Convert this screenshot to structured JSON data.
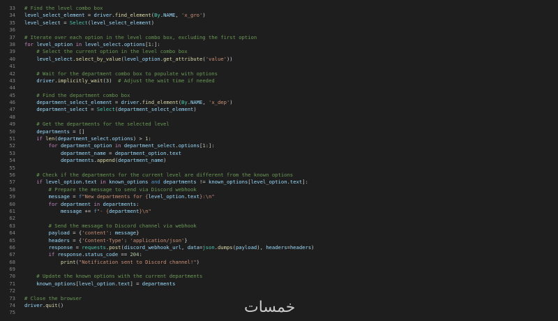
{
  "editor": {
    "language": "python",
    "watermark": "خمسات",
    "lines": [
      {
        "n": "33",
        "t": [
          [
            "c",
            "# Find the level combo box"
          ]
        ]
      },
      {
        "n": "34",
        "t": [
          [
            "v",
            "level_select_element"
          ],
          [
            "p",
            " = "
          ],
          [
            "v",
            "driver"
          ],
          [
            "p",
            "."
          ],
          [
            "f",
            "find_element"
          ],
          [
            "p",
            "("
          ],
          [
            "t",
            "By"
          ],
          [
            "p",
            "."
          ],
          [
            "v",
            "NAME"
          ],
          [
            "p",
            ", "
          ],
          [
            "s",
            "'x_gro'"
          ],
          [
            "p",
            ")"
          ]
        ]
      },
      {
        "n": "35",
        "t": [
          [
            "v",
            "level_select"
          ],
          [
            "p",
            " = "
          ],
          [
            "t",
            "Select"
          ],
          [
            "p",
            "("
          ],
          [
            "v",
            "level_select_element"
          ],
          [
            "p",
            ")"
          ]
        ]
      },
      {
        "n": "36",
        "t": []
      },
      {
        "n": "37",
        "t": [
          [
            "c",
            "# Iterate over each option in the level combo box, excluding the first option"
          ]
        ]
      },
      {
        "n": "38",
        "t": [
          [
            "k",
            "for"
          ],
          [
            "p",
            " "
          ],
          [
            "v",
            "level_option"
          ],
          [
            "p",
            " "
          ],
          [
            "k",
            "in"
          ],
          [
            "p",
            " "
          ],
          [
            "v",
            "level_select"
          ],
          [
            "p",
            "."
          ],
          [
            "v",
            "options"
          ],
          [
            "p",
            "["
          ],
          [
            "n",
            "1"
          ],
          [
            "p",
            ":]:"
          ]
        ]
      },
      {
        "n": "39",
        "t": [
          [
            "p",
            "    "
          ],
          [
            "c",
            "# Select the current option in the level combo box"
          ]
        ]
      },
      {
        "n": "40",
        "t": [
          [
            "p",
            "    "
          ],
          [
            "v",
            "level_select"
          ],
          [
            "p",
            "."
          ],
          [
            "f",
            "select_by_value"
          ],
          [
            "p",
            "("
          ],
          [
            "v",
            "level_option"
          ],
          [
            "p",
            "."
          ],
          [
            "f",
            "get_attribute"
          ],
          [
            "p",
            "("
          ],
          [
            "s",
            "'value'"
          ],
          [
            "p",
            "))"
          ]
        ]
      },
      {
        "n": "41",
        "t": []
      },
      {
        "n": "42",
        "t": [
          [
            "p",
            "    "
          ],
          [
            "c",
            "# Wait for the department combo box to populate with options"
          ]
        ]
      },
      {
        "n": "43",
        "t": [
          [
            "p",
            "    "
          ],
          [
            "v",
            "driver"
          ],
          [
            "p",
            "."
          ],
          [
            "f",
            "implicitly_wait"
          ],
          [
            "p",
            "("
          ],
          [
            "n",
            "3"
          ],
          [
            "p",
            ")  "
          ],
          [
            "c",
            "# Adjust the wait time if needed"
          ]
        ]
      },
      {
        "n": "44",
        "t": []
      },
      {
        "n": "45",
        "t": [
          [
            "p",
            "    "
          ],
          [
            "c",
            "# Find the department combo box"
          ]
        ]
      },
      {
        "n": "46",
        "t": [
          [
            "p",
            "    "
          ],
          [
            "v",
            "department_select_element"
          ],
          [
            "p",
            " = "
          ],
          [
            "v",
            "driver"
          ],
          [
            "p",
            "."
          ],
          [
            "f",
            "find_element"
          ],
          [
            "p",
            "("
          ],
          [
            "t",
            "By"
          ],
          [
            "p",
            "."
          ],
          [
            "v",
            "NAME"
          ],
          [
            "p",
            ", "
          ],
          [
            "s",
            "'x_dep'"
          ],
          [
            "p",
            ")"
          ]
        ]
      },
      {
        "n": "47",
        "t": [
          [
            "p",
            "    "
          ],
          [
            "v",
            "department_select"
          ],
          [
            "p",
            " = "
          ],
          [
            "t",
            "Select"
          ],
          [
            "p",
            "("
          ],
          [
            "v",
            "department_select_element"
          ],
          [
            "p",
            ")"
          ]
        ]
      },
      {
        "n": "48",
        "t": []
      },
      {
        "n": "49",
        "t": [
          [
            "p",
            "    "
          ],
          [
            "c",
            "# Get the departments for the selected level"
          ]
        ]
      },
      {
        "n": "50",
        "t": [
          [
            "p",
            "    "
          ],
          [
            "v",
            "departments"
          ],
          [
            "p",
            " = []"
          ]
        ]
      },
      {
        "n": "51",
        "t": [
          [
            "p",
            "    "
          ],
          [
            "k",
            "if"
          ],
          [
            "p",
            " "
          ],
          [
            "f",
            "len"
          ],
          [
            "p",
            "("
          ],
          [
            "v",
            "department_select"
          ],
          [
            "p",
            "."
          ],
          [
            "v",
            "options"
          ],
          [
            "p",
            ") > "
          ],
          [
            "n",
            "1"
          ],
          [
            "p",
            ":"
          ]
        ]
      },
      {
        "n": "52",
        "t": [
          [
            "p",
            "        "
          ],
          [
            "k",
            "for"
          ],
          [
            "p",
            " "
          ],
          [
            "v",
            "department_option"
          ],
          [
            "p",
            " "
          ],
          [
            "k",
            "in"
          ],
          [
            "p",
            " "
          ],
          [
            "v",
            "department_select"
          ],
          [
            "p",
            "."
          ],
          [
            "v",
            "options"
          ],
          [
            "p",
            "["
          ],
          [
            "n",
            "1"
          ],
          [
            "p",
            ":]:"
          ]
        ]
      },
      {
        "n": "53",
        "t": [
          [
            "p",
            "            "
          ],
          [
            "v",
            "department_name"
          ],
          [
            "p",
            " = "
          ],
          [
            "v",
            "department_option"
          ],
          [
            "p",
            "."
          ],
          [
            "v",
            "text"
          ]
        ]
      },
      {
        "n": "54",
        "t": [
          [
            "p",
            "            "
          ],
          [
            "v",
            "departments"
          ],
          [
            "p",
            "."
          ],
          [
            "f",
            "append"
          ],
          [
            "p",
            "("
          ],
          [
            "v",
            "department_name"
          ],
          [
            "p",
            ")"
          ]
        ]
      },
      {
        "n": "55",
        "t": []
      },
      {
        "n": "56",
        "t": [
          [
            "p",
            "    "
          ],
          [
            "c",
            "# Check if the departments for the current level are different from the known options"
          ]
        ]
      },
      {
        "n": "57",
        "t": [
          [
            "p",
            "    "
          ],
          [
            "k",
            "if"
          ],
          [
            "p",
            " "
          ],
          [
            "v",
            "level_option"
          ],
          [
            "p",
            "."
          ],
          [
            "v",
            "text"
          ],
          [
            "p",
            " "
          ],
          [
            "k",
            "in"
          ],
          [
            "p",
            " "
          ],
          [
            "v",
            "known_options"
          ],
          [
            "p",
            " "
          ],
          [
            "b",
            "and"
          ],
          [
            "p",
            " "
          ],
          [
            "v",
            "departments"
          ],
          [
            "p",
            " != "
          ],
          [
            "v",
            "known_options"
          ],
          [
            "p",
            "["
          ],
          [
            "v",
            "level_option"
          ],
          [
            "p",
            "."
          ],
          [
            "v",
            "text"
          ],
          [
            "p",
            "]:"
          ]
        ]
      },
      {
        "n": "58",
        "t": [
          [
            "p",
            "        "
          ],
          [
            "c",
            "# Prepare the message to send via Discord webhook"
          ]
        ]
      },
      {
        "n": "59",
        "t": [
          [
            "p",
            "        "
          ],
          [
            "v",
            "message"
          ],
          [
            "p",
            " = "
          ],
          [
            "b",
            "f"
          ],
          [
            "s",
            "\"New departments for {"
          ],
          [
            "v",
            "level_option"
          ],
          [
            "p",
            "."
          ],
          [
            "v",
            "text"
          ],
          [
            "s",
            "}:\\n\""
          ]
        ]
      },
      {
        "n": "60",
        "t": [
          [
            "p",
            "        "
          ],
          [
            "k",
            "for"
          ],
          [
            "p",
            " "
          ],
          [
            "v",
            "department"
          ],
          [
            "p",
            " "
          ],
          [
            "k",
            "in"
          ],
          [
            "p",
            " "
          ],
          [
            "v",
            "departments"
          ],
          [
            "p",
            ":"
          ]
        ]
      },
      {
        "n": "61",
        "t": [
          [
            "p",
            "            "
          ],
          [
            "v",
            "message"
          ],
          [
            "p",
            " += "
          ],
          [
            "b",
            "f"
          ],
          [
            "s",
            "\"- {"
          ],
          [
            "v",
            "department"
          ],
          [
            "s",
            "}\\n\""
          ]
        ]
      },
      {
        "n": "62",
        "t": []
      },
      {
        "n": "63",
        "t": [
          [
            "p",
            "        "
          ],
          [
            "c",
            "# Send the message to Discord channel via webhook"
          ]
        ]
      },
      {
        "n": "64",
        "t": [
          [
            "p",
            "        "
          ],
          [
            "v",
            "payload"
          ],
          [
            "p",
            " = {"
          ],
          [
            "s",
            "'content'"
          ],
          [
            "p",
            ": "
          ],
          [
            "v",
            "message"
          ],
          [
            "p",
            "}"
          ]
        ]
      },
      {
        "n": "65",
        "t": [
          [
            "p",
            "        "
          ],
          [
            "v",
            "headers"
          ],
          [
            "p",
            " = {"
          ],
          [
            "s",
            "'Content-Type'"
          ],
          [
            "p",
            ": "
          ],
          [
            "s",
            "'application/json'"
          ],
          [
            "p",
            "}"
          ]
        ]
      },
      {
        "n": "66",
        "t": [
          [
            "p",
            "        "
          ],
          [
            "v",
            "response"
          ],
          [
            "p",
            " = "
          ],
          [
            "t",
            "requests"
          ],
          [
            "p",
            "."
          ],
          [
            "f",
            "post"
          ],
          [
            "p",
            "("
          ],
          [
            "v",
            "discord_webhook_url"
          ],
          [
            "p",
            ", "
          ],
          [
            "v",
            "data"
          ],
          [
            "p",
            "="
          ],
          [
            "t",
            "json"
          ],
          [
            "p",
            "."
          ],
          [
            "f",
            "dumps"
          ],
          [
            "p",
            "("
          ],
          [
            "v",
            "payload"
          ],
          [
            "p",
            "), "
          ],
          [
            "v",
            "headers"
          ],
          [
            "p",
            "="
          ],
          [
            "v",
            "headers"
          ],
          [
            "p",
            ")"
          ]
        ]
      },
      {
        "n": "67",
        "t": [
          [
            "p",
            "        "
          ],
          [
            "k",
            "if"
          ],
          [
            "p",
            " "
          ],
          [
            "v",
            "response"
          ],
          [
            "p",
            "."
          ],
          [
            "v",
            "status_code"
          ],
          [
            "p",
            " == "
          ],
          [
            "n",
            "204"
          ],
          [
            "p",
            ":"
          ]
        ]
      },
      {
        "n": "68",
        "t": [
          [
            "p",
            "            "
          ],
          [
            "f",
            "print"
          ],
          [
            "p",
            "("
          ],
          [
            "s",
            "\"Notification sent to Discord channel!\""
          ],
          [
            "p",
            ")"
          ]
        ]
      },
      {
        "n": "69",
        "t": []
      },
      {
        "n": "70",
        "t": [
          [
            "p",
            "    "
          ],
          [
            "c",
            "# Update the known options with the current departments"
          ]
        ]
      },
      {
        "n": "71",
        "t": [
          [
            "p",
            "    "
          ],
          [
            "v",
            "known_options"
          ],
          [
            "p",
            "["
          ],
          [
            "v",
            "level_option"
          ],
          [
            "p",
            "."
          ],
          [
            "v",
            "text"
          ],
          [
            "p",
            "] = "
          ],
          [
            "v",
            "departments"
          ]
        ]
      },
      {
        "n": "72",
        "t": []
      },
      {
        "n": "73",
        "t": [
          [
            "c",
            "# Close the browser"
          ]
        ]
      },
      {
        "n": "74",
        "t": [
          [
            "v",
            "driver"
          ],
          [
            "p",
            "."
          ],
          [
            "f",
            "quit"
          ],
          [
            "p",
            "()"
          ]
        ]
      },
      {
        "n": "75",
        "t": []
      }
    ]
  }
}
